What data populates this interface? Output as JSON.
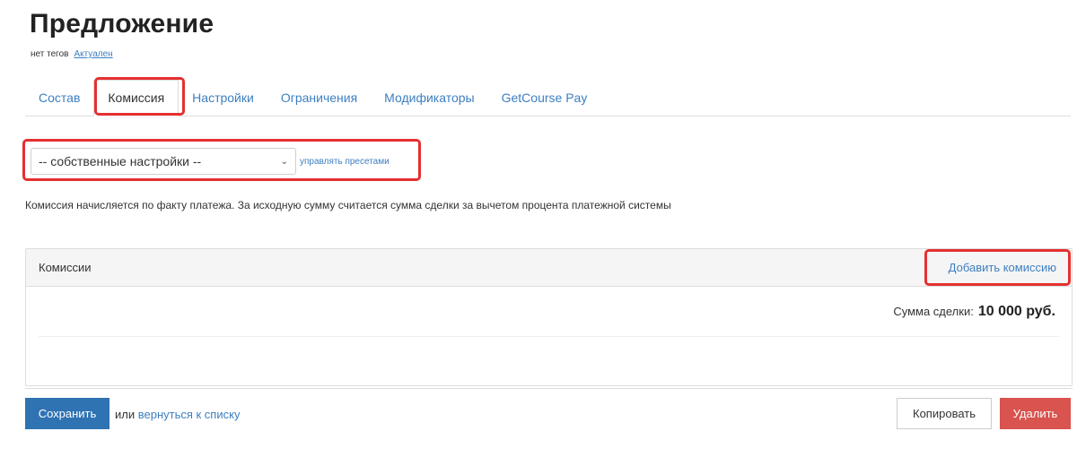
{
  "header": {
    "title": "Предложение",
    "tags": "нет тегов",
    "status": "Актуален"
  },
  "tabs": [
    {
      "label": "Состав"
    },
    {
      "label": "Комиссия"
    },
    {
      "label": "Настройки"
    },
    {
      "label": "Ограничения"
    },
    {
      "label": "Модификаторы"
    },
    {
      "label": "GetCourse Pay"
    }
  ],
  "presets": {
    "selected": "-- собственные настройки --",
    "manage_link": "управлять пресетами"
  },
  "info_text": "Комиссия начисляется по факту платежа. За исходную сумму считается сумма сделки за вычетом процента платежной системы",
  "commissions": {
    "title": "Комиссии",
    "add_label": "Добавить комиссию",
    "sum_label": "Сумма сделки:",
    "sum_value": "10 000 руб."
  },
  "footer": {
    "save_label": "Сохранить",
    "or_text": "или",
    "back_link": "вернуться к списку",
    "copy_label": "Копировать",
    "delete_label": "Удалить"
  },
  "colors": {
    "link": "#3d7fc1",
    "primary": "#2f73b2",
    "danger": "#d9534f",
    "highlight": "#e53030"
  }
}
